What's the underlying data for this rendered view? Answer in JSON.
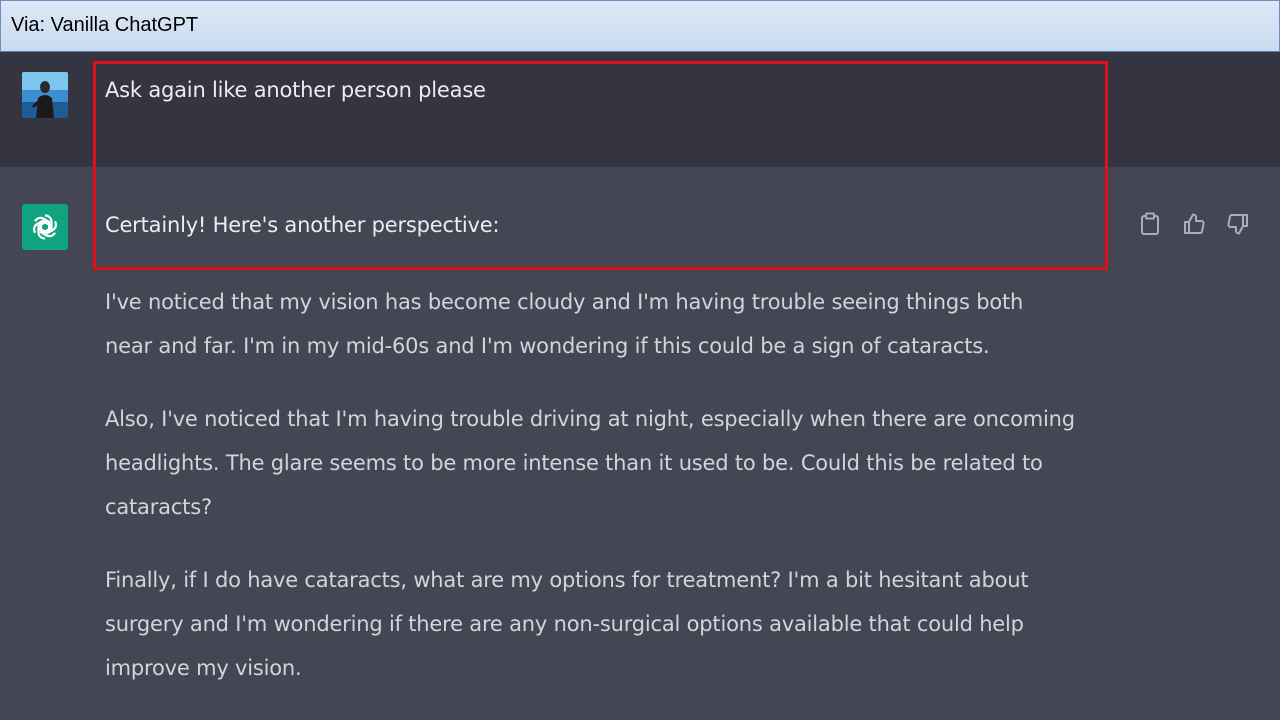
{
  "caption": {
    "text": "Via: Vanilla ChatGPT"
  },
  "user_message": {
    "text": "Ask again like another person please"
  },
  "assistant_message": {
    "intro": "Certainly! Here's another perspective:",
    "paragraphs": [
      {
        "lines": [
          "I've noticed that my vision has become cloudy and I'm having trouble seeing things both",
          "near and far. I'm in my mid-60s and I'm wondering if this could be a sign of cataracts."
        ]
      },
      {
        "lines": [
          "Also, I've noticed that I'm having trouble driving at night, especially when there are oncoming",
          "headlights. The glare seems to be more intense than it used to be. Could this be related to",
          "cataracts?"
        ]
      },
      {
        "lines": [
          "Finally, if I do have cataracts, what are my options for treatment? I'm a bit hesitant about",
          "surgery and I'm wondering if there are any non-surgical options available that could help",
          "improve my vision."
        ]
      }
    ],
    "actions": [
      {
        "icon": "clipboard-icon"
      },
      {
        "icon": "thumbs-up-icon"
      },
      {
        "icon": "thumbs-down-icon"
      }
    ]
  },
  "colors": {
    "user_row_bg": "#343541",
    "assistant_row_bg": "#444654",
    "gpt_avatar_bg": "#10a37f",
    "highlight_border": "#e0101a",
    "text_primary": "#ececf1",
    "text_secondary": "#d1d5db"
  }
}
